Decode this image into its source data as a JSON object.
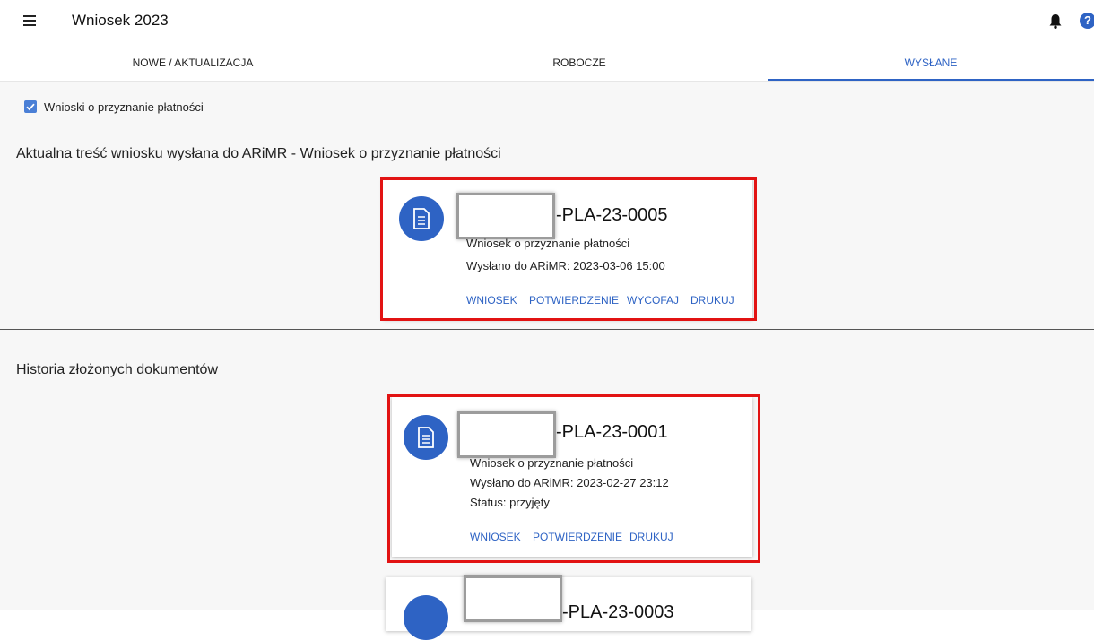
{
  "app": {
    "title": "Wniosek 2023"
  },
  "tabs": [
    {
      "label": "NOWE / AKTUALIZACJA",
      "active": false
    },
    {
      "label": "ROBOCZE",
      "active": false
    },
    {
      "label": "WYSŁANE",
      "active": true
    }
  ],
  "filter": {
    "label": "Wnioski o przyznanie płatności",
    "checked": true
  },
  "current_section": {
    "title": "Aktualna treść wniosku wysłana do ARiMR - Wniosek o przyznanie płatności",
    "card": {
      "number": "-PLA-23-0005",
      "type": "Wniosek o przyznanie płatności",
      "sent": "Wysłano do ARiMR: 2023-03-06 15:00",
      "actions": [
        "WNIOSEK",
        "POTWIERDZENIE",
        "WYCOFAJ",
        "DRUKUJ"
      ]
    }
  },
  "history_section": {
    "title": "Historia złożonych dokumentów",
    "cards": [
      {
        "number": "-PLA-23-0001",
        "type": "Wniosek o przyznanie płatności",
        "sent": "Wysłano do ARiMR: 2023-02-27 23:12",
        "status": "Status: przyjęty",
        "actions": [
          "WNIOSEK",
          "POTWIERDZENIE",
          "DRUKUJ"
        ]
      },
      {
        "number": "-PLA-23-0003"
      }
    ]
  },
  "colors": {
    "accent": "#2e63c4",
    "highlight": "#e21313"
  },
  "help": {
    "glyph": "?"
  }
}
